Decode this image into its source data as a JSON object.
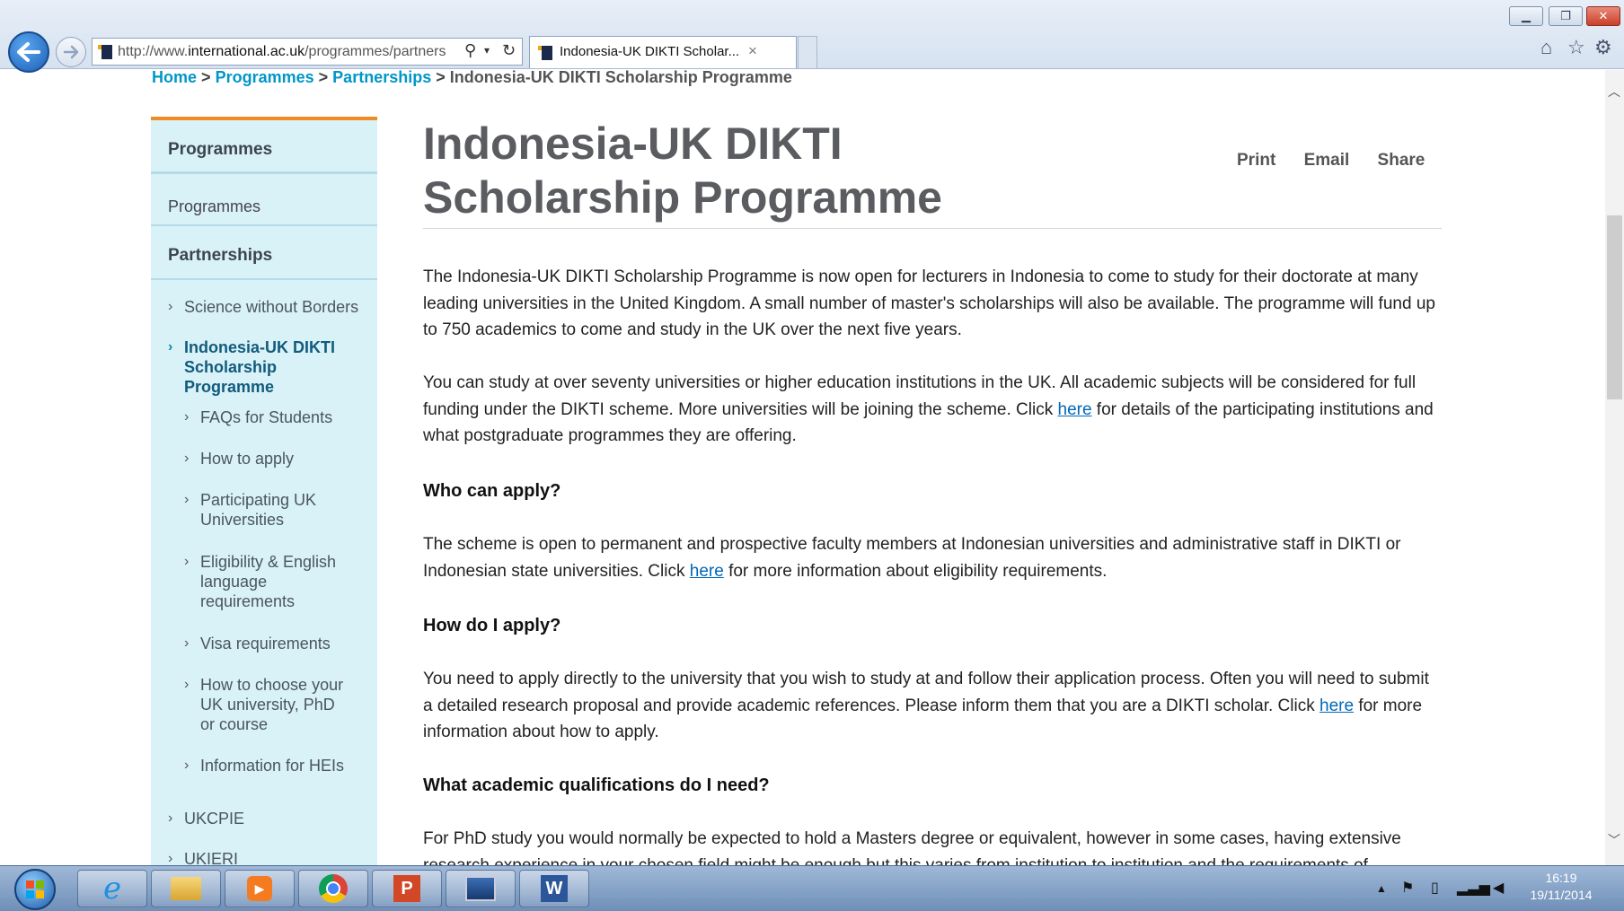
{
  "browser": {
    "address_url": "http://www.international.ac.uk/programmes/partners",
    "address_prefix": "http://www.",
    "address_domain": "international.ac.uk",
    "address_path": "/programmes/partners",
    "tab_title": "Indonesia-UK DIKTI Scholar...",
    "tab_close": "×",
    "icons": [
      "back-icon",
      "forward-icon",
      "search-icon",
      "dropdown-icon",
      "refresh-icon",
      "home-icon",
      "favorites-star-icon",
      "settings-gear-icon"
    ]
  },
  "breadcrumb": {
    "home": "Home",
    "programmes": "Programmes",
    "partnerships": "Partnerships",
    "current": "Indonesia-UK DIKTI Scholarship Programme",
    "separator": ">"
  },
  "sidebar": {
    "heading": "Programmes",
    "link_programmes": "Programmes",
    "section_partnerships": "Partnerships",
    "items": [
      {
        "label": "Science without Borders"
      },
      {
        "label": "Indonesia-UK DIKTI Scholarship Programme",
        "active": true
      },
      {
        "label": "FAQs for Students"
      },
      {
        "label": "How to apply"
      },
      {
        "label": "Participating UK Universities"
      },
      {
        "label": "Eligibility & English language requirements"
      },
      {
        "label": "Visa requirements"
      },
      {
        "label": "How to choose your UK university, PhD or course"
      },
      {
        "label": "Information for HEIs"
      },
      {
        "label": "UKCPIE"
      },
      {
        "label": "UKIERI"
      }
    ]
  },
  "page": {
    "title": "Indonesia-UK DIKTI Scholarship Programme",
    "actions": {
      "print": "Print",
      "email": "Email",
      "share": "Share"
    },
    "p1": "The Indonesia-UK DIKTI Scholarship Programme is now open for lecturers in Indonesia to come to study for their doctorate at many leading universities in the United Kingdom. A small number of master's scholarships will also be available. The programme will fund up to 750 academics to come and study in the UK over the next five years.",
    "p2_a": "You can study at over seventy universities or higher education institutions in the UK. All academic subjects will be considered for full funding under the DIKTI scheme. More universities will be joining the scheme. Click ",
    "p2_link": "here",
    "p2_b": " for details of the participating institutions and what postgraduate programmes they are offering.",
    "h_who": "Who can apply?",
    "p3_a": "The scheme is open to permanent and prospective faculty members at Indonesian universities and administrative staff in DIKTI or Indonesian state universities. Click ",
    "p3_link": "here",
    "p3_b": " for more information about eligibility requirements.",
    "h_how": "How do I apply?",
    "p4_a": "You need to apply directly to the university that you wish to study at and follow their application process. Often you will need to submit a detailed research proposal and provide academic references. Please inform them that you are a DIKTI scholar. Click ",
    "p4_link": "here",
    "p4_b": " for more information about how to apply.",
    "h_qual": "What academic qualifications do I need?",
    "p5": "For PhD study you would normally be expected to hold a Masters degree or equivalent, however in some cases, having extensive research experience in your chosen field might be enough but this varies from institution to institution and the requirements of"
  },
  "taskbar": {
    "apps": [
      "start-icon",
      "internet-explorer-icon",
      "file-explorer-icon",
      "media-player-icon",
      "chrome-icon",
      "powerpoint-icon",
      "remote-desktop-icon",
      "word-icon"
    ],
    "time": "16:19",
    "date": "19/11/2014"
  },
  "colors": {
    "link": "#0096c8",
    "sidebar_bg": "#d9f2f8",
    "sidebar_accent": "#f08a24",
    "title_gray": "#5a5c60"
  }
}
